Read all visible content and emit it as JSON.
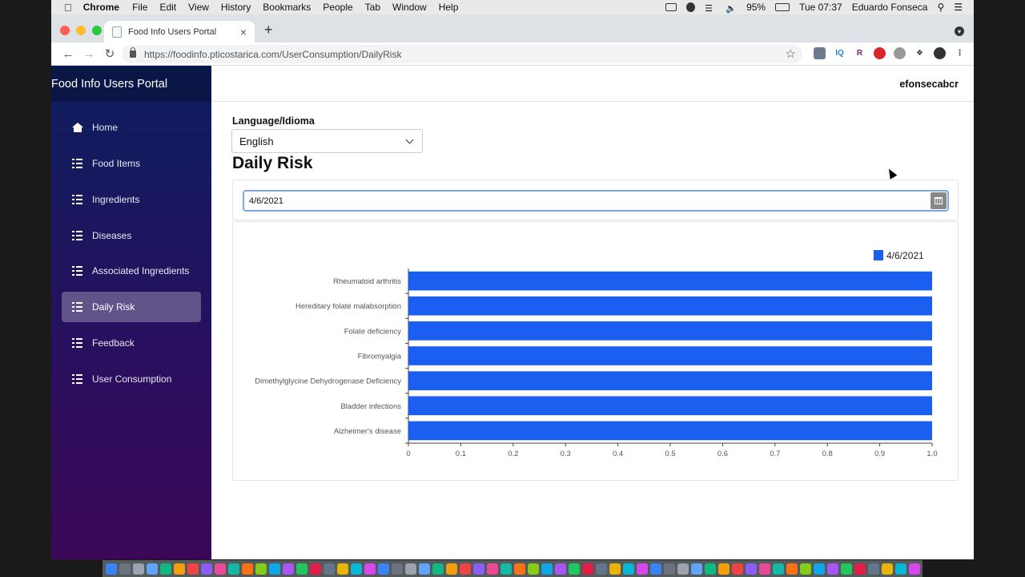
{
  "menubar": {
    "app_name": "Chrome",
    "items": [
      "File",
      "Edit",
      "View",
      "History",
      "Bookmarks",
      "People",
      "Tab",
      "Window",
      "Help"
    ],
    "battery": "95%",
    "clock": "Tue 07:37",
    "user": "Eduardo Fonseca"
  },
  "browser": {
    "tab_title": "Food Info Users Portal",
    "url": "https://foodinfo.pticostarica.com/UserConsumption/DailyRisk"
  },
  "sidebar": {
    "brand": "Food Info Users Portal",
    "items": [
      {
        "label": "Home",
        "icon": "home-icon"
      },
      {
        "label": "Food Items",
        "icon": "list-icon"
      },
      {
        "label": "Ingredients",
        "icon": "list-icon"
      },
      {
        "label": "Diseases",
        "icon": "list-icon"
      },
      {
        "label": "Associated Ingredients",
        "icon": "list-icon"
      },
      {
        "label": "Daily Risk",
        "icon": "list-icon",
        "active": true
      },
      {
        "label": "Feedback",
        "icon": "list-icon"
      },
      {
        "label": "User Consumption",
        "icon": "list-icon"
      }
    ]
  },
  "header": {
    "username": "efonsecabcr"
  },
  "main": {
    "language_label": "Language/Idioma",
    "language_value": "English",
    "page_title": "Daily Risk",
    "date_value": "4/6/2021"
  },
  "colors": {
    "bar": "#1a5ff0",
    "sidebar_top": "#0c1f5e",
    "sidebar_bottom": "#3a0856"
  },
  "chart_data": {
    "type": "bar",
    "orientation": "horizontal",
    "categories": [
      "Rheumatoid arthritis",
      "Hereditary folate malabsorption",
      "Folate deficiency",
      "Fibromyalgia",
      "Dimethylglycine Dehydrogenase Deficiency",
      "Bladder infections",
      "Alzheimer's disease"
    ],
    "series": [
      {
        "name": "4/6/2021",
        "values": [
          1.0,
          1.0,
          1.0,
          1.0,
          1.0,
          1.0,
          1.0
        ]
      }
    ],
    "xlim": [
      0,
      1.0
    ],
    "xticks": [
      "0",
      "0.1",
      "0.2",
      "0.3",
      "0.4",
      "0.5",
      "0.6",
      "0.7",
      "0.8",
      "0.9",
      "1.0"
    ],
    "legend_position": "top-right",
    "grid": false
  }
}
